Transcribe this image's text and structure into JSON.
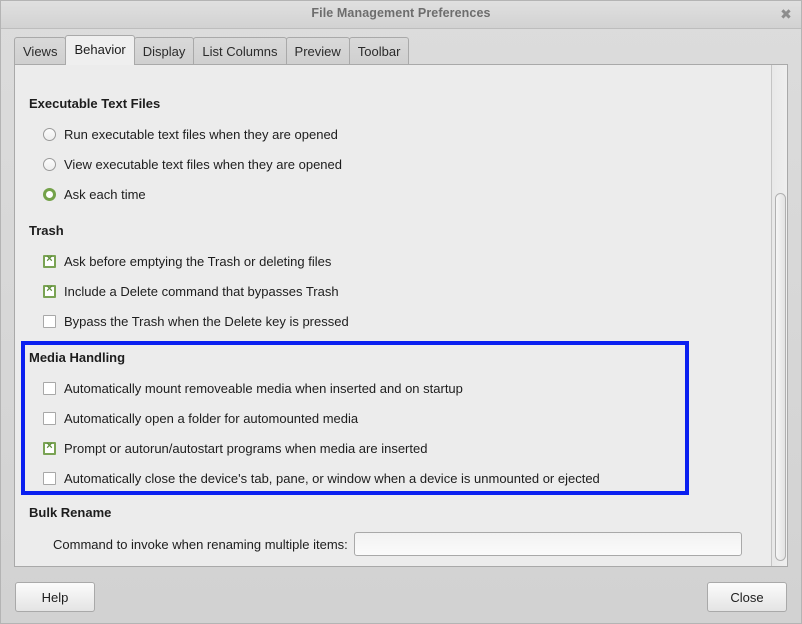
{
  "window": {
    "title": "File Management Preferences",
    "close_icon": "close-icon",
    "close_glyph": "✖"
  },
  "tabs": [
    {
      "label": "Views",
      "active": false
    },
    {
      "label": "Behavior",
      "active": true
    },
    {
      "label": "Display",
      "active": false
    },
    {
      "label": "List Columns",
      "active": false
    },
    {
      "label": "Preview",
      "active": false
    },
    {
      "label": "Toolbar",
      "active": false
    }
  ],
  "sections": {
    "executable": {
      "title": "Executable Text Files",
      "options": [
        {
          "label": "Run executable text files when they are opened",
          "checked": false
        },
        {
          "label": "View executable text files when they are opened",
          "checked": false
        },
        {
          "label": "Ask each time",
          "checked": true
        }
      ]
    },
    "trash": {
      "title": "Trash",
      "options": [
        {
          "label": "Ask before emptying the Trash or deleting files",
          "checked": true
        },
        {
          "label": "Include a Delete command that bypasses Trash",
          "checked": true
        },
        {
          "label": "Bypass the Trash when the Delete key is pressed",
          "checked": false
        }
      ]
    },
    "media": {
      "title": "Media Handling",
      "highlighted": true,
      "options": [
        {
          "label": "Automatically mount removeable media when inserted and on startup",
          "checked": false
        },
        {
          "label": "Automatically open a folder for automounted media",
          "checked": false
        },
        {
          "label": "Prompt or autorun/autostart programs when media are inserted",
          "checked": true
        },
        {
          "label": "Automatically close the device's tab, pane, or window when a device is unmounted or ejected",
          "checked": false
        }
      ]
    },
    "bulk_rename": {
      "title": "Bulk Rename",
      "command_label": "Command to invoke when renaming multiple items:",
      "command_value": "",
      "command_placeholder": ""
    }
  },
  "footer": {
    "help_label": "Help",
    "close_label": "Close"
  },
  "colors": {
    "highlight": "#0a1ff0",
    "check_green": "#7aa354",
    "radio_green": "#74a24a"
  }
}
